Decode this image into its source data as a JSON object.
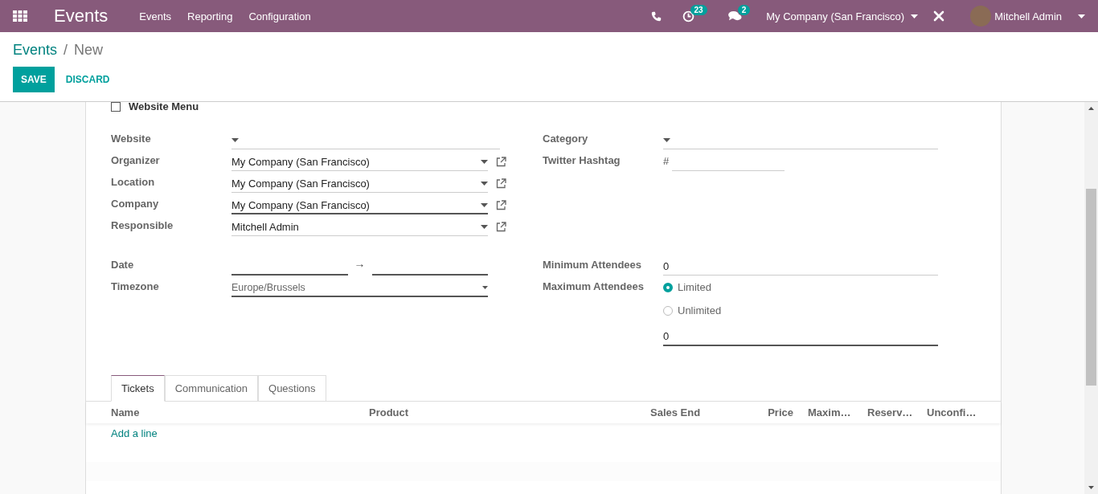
{
  "navbar": {
    "app_title": "Events",
    "menu": [
      {
        "label": "Events"
      },
      {
        "label": "Reporting"
      },
      {
        "label": "Configuration"
      }
    ],
    "activity_count": "23",
    "message_count": "2",
    "company": "My Company (San Francisco)",
    "user": "Mitchell Admin"
  },
  "breadcrumb": {
    "parent": "Events",
    "separator": "/",
    "current": "New"
  },
  "buttons": {
    "save": "SAVE",
    "discard": "DISCARD"
  },
  "website_menu": {
    "label": "Website Menu",
    "checked": false
  },
  "left_fields": [
    {
      "label": "Website",
      "external_link": false,
      "focused": false
    },
    {
      "label": "Organizer",
      "value": "My Company (San Francisco)",
      "external_link": true,
      "focused": false
    },
    {
      "label": "Location",
      "value": "My Company (San Francisco)",
      "external_link": true,
      "focused": false
    },
    {
      "label": "Company",
      "value": "My Company (San Francisco)",
      "external_link": true,
      "focused": true
    },
    {
      "label": "Responsible",
      "value": "Mitchell Admin",
      "external_link": true,
      "focused": false
    }
  ],
  "right_fields": [
    {
      "label": "Category",
      "kind": "select"
    },
    {
      "label": "Twitter Hashtag",
      "prefix": "#",
      "kind": "hashtag"
    }
  ],
  "date": {
    "label": "Date",
    "arrow": "→"
  },
  "timezone": {
    "label": "Timezone",
    "value": "Europe/Brussels"
  },
  "minimum_attendees": {
    "label": "Minimum Attendees",
    "value": "0"
  },
  "maximum_attendees": {
    "label": "Maximum Attendees",
    "options": [
      {
        "label": "Limited",
        "selected": true
      },
      {
        "label": "Unlimited",
        "selected": false
      }
    ],
    "value": "0"
  },
  "tabs": [
    {
      "label": "Tickets",
      "selected": true
    },
    {
      "label": "Communication",
      "selected": false
    },
    {
      "label": "Questions",
      "selected": false
    }
  ],
  "table": {
    "columns": [
      {
        "label": "Name"
      },
      {
        "label": "Product"
      },
      {
        "label": "Sales End"
      },
      {
        "label": "Price"
      },
      {
        "label": "Maxim…"
      },
      {
        "label": "Reserv…"
      },
      {
        "label": "Unconfi…"
      }
    ],
    "add_line": "Add a line"
  }
}
